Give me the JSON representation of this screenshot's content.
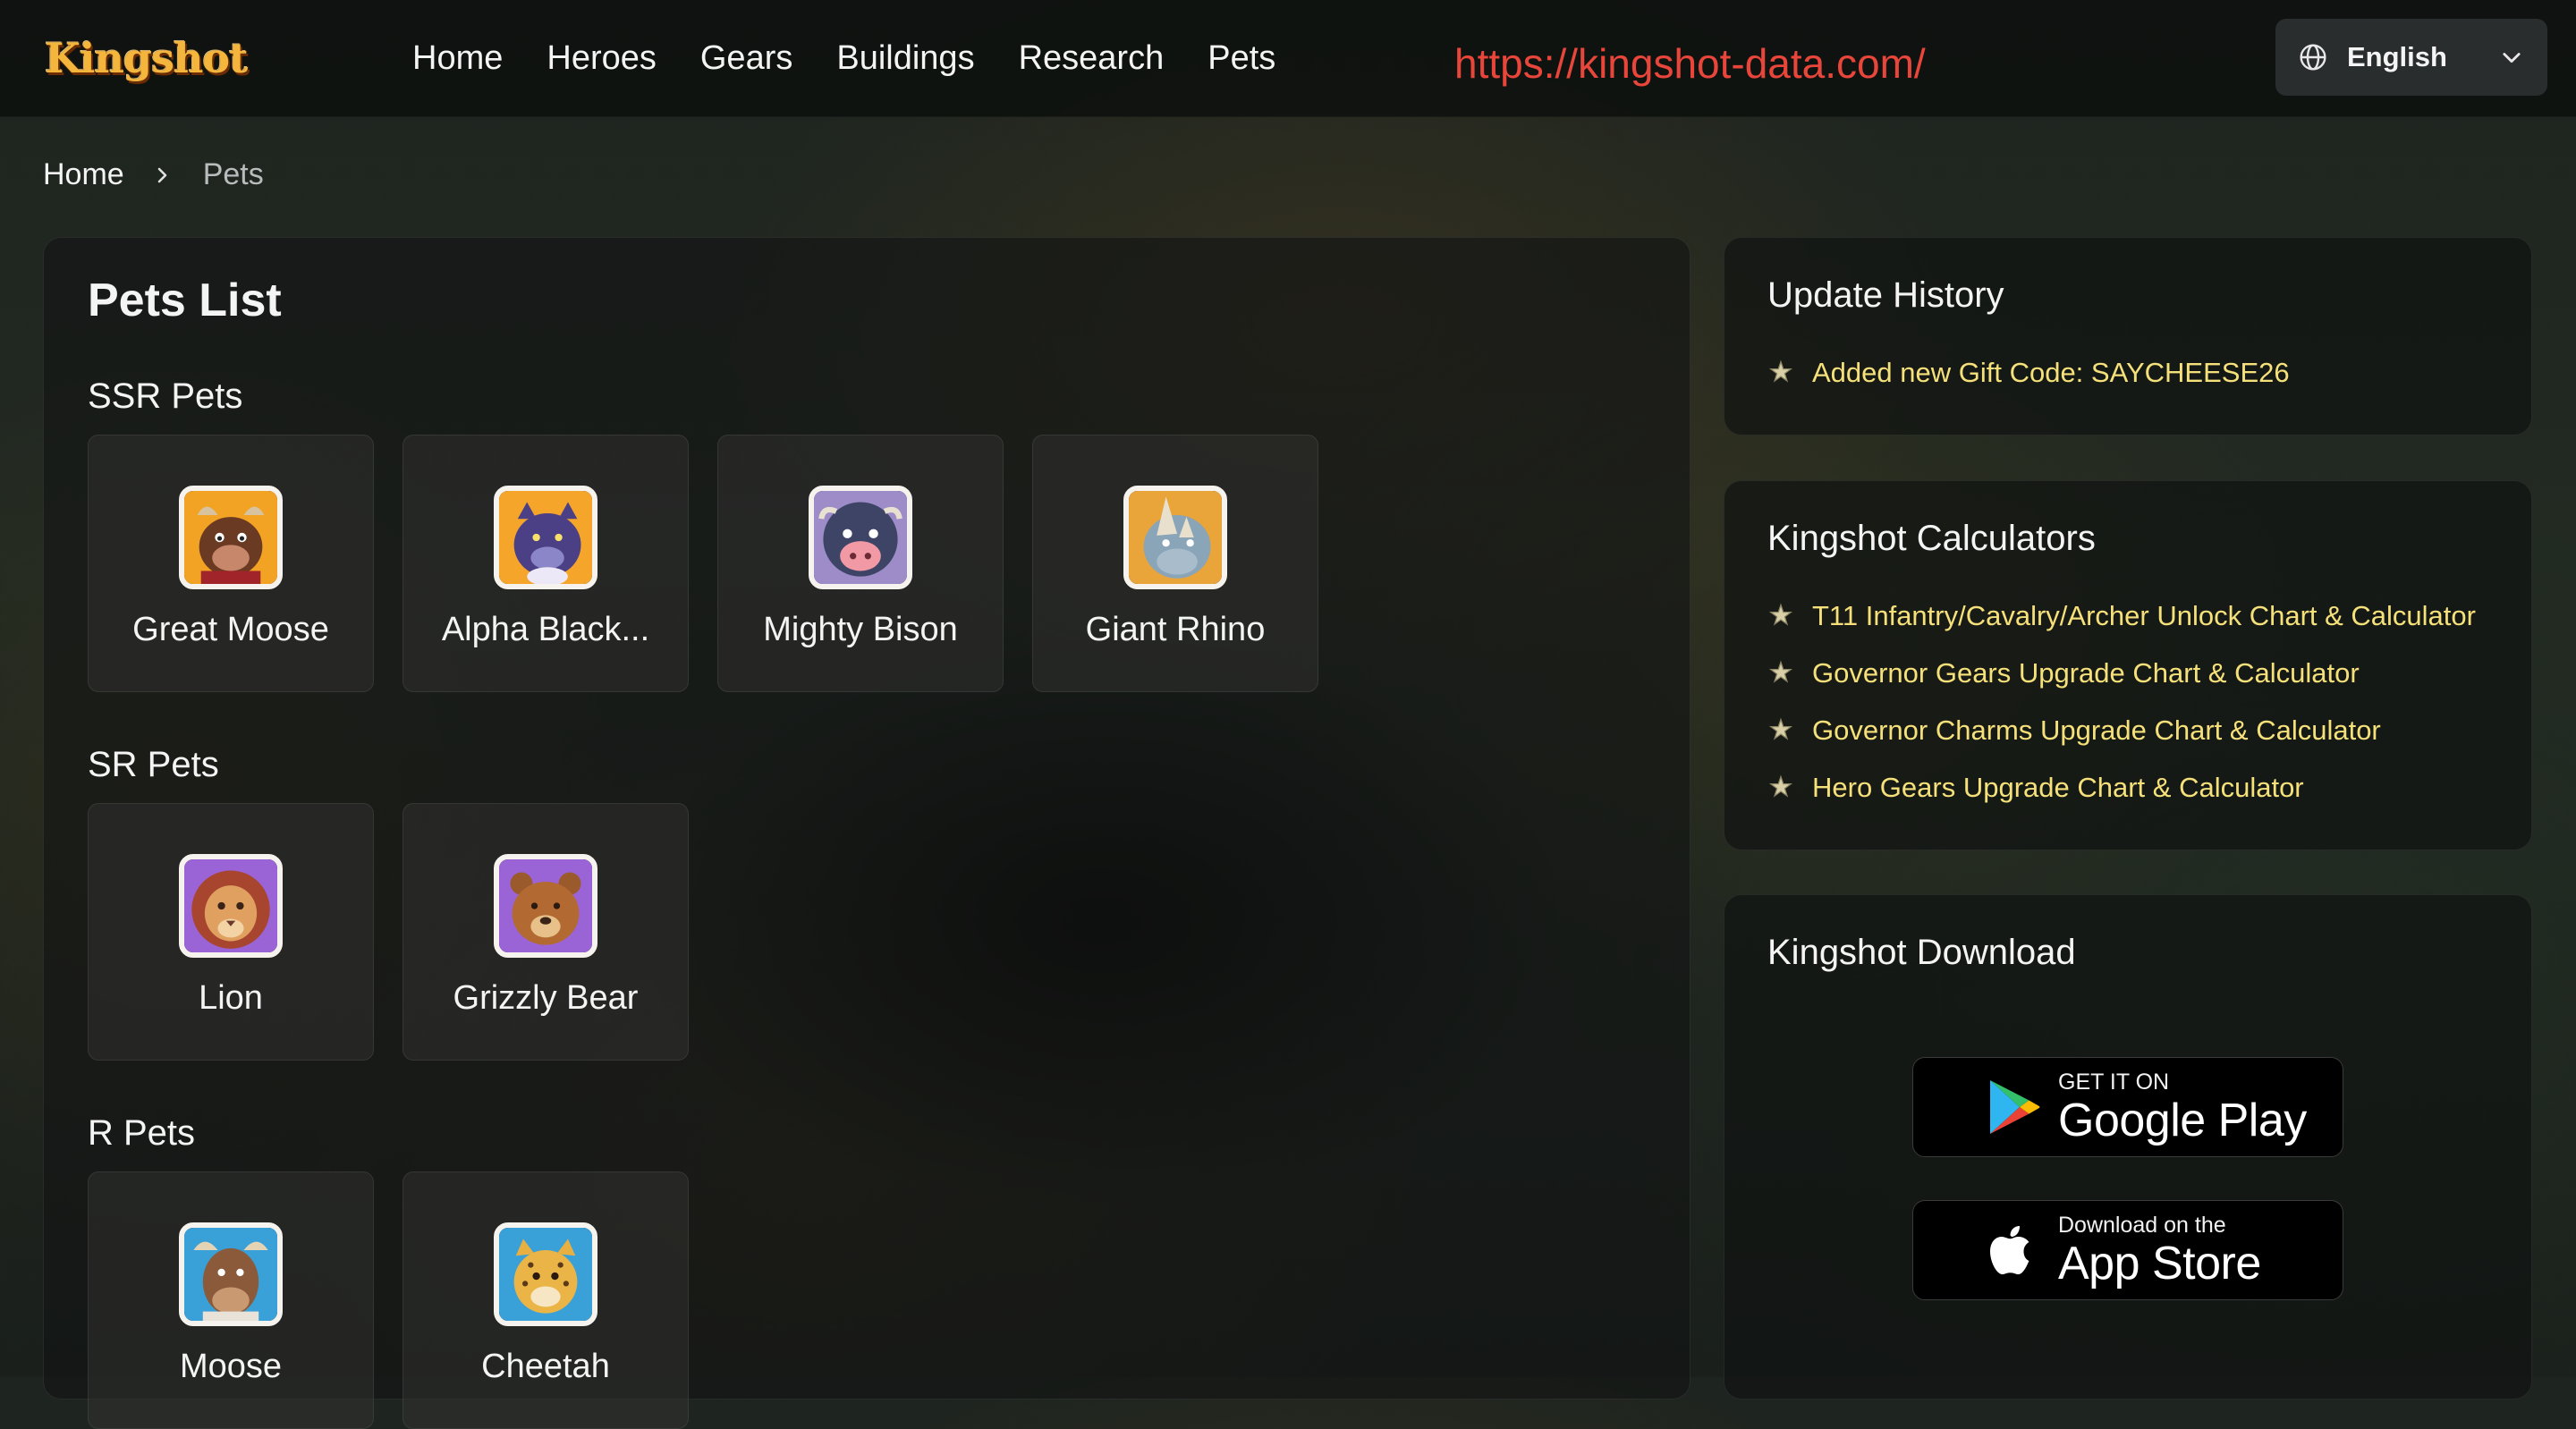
{
  "header": {
    "logo_text": "Kingshot",
    "nav": [
      "Home",
      "Heroes",
      "Gears",
      "Buildings",
      "Research",
      "Pets"
    ],
    "site_url": "https://kingshot-data.com/",
    "language": {
      "label": "English",
      "icon": "globe-icon"
    },
    "accent_color": "#e8453b"
  },
  "breadcrumb": {
    "home": "Home",
    "current": "Pets"
  },
  "main": {
    "title": "Pets List",
    "sections": [
      {
        "title": "SSR Pets",
        "pets": [
          "Great Moose",
          "Alpha Black...",
          "Mighty Bison",
          "Giant Rhino"
        ]
      },
      {
        "title": "SR Pets",
        "pets": [
          "Lion",
          "Grizzly Bear"
        ]
      },
      {
        "title": "R Pets",
        "pets": [
          "Moose",
          "Cheetah"
        ]
      }
    ]
  },
  "sidebar": {
    "update_history": {
      "title": "Update History",
      "items": [
        "Added new Gift Code: SAYCHEESE26"
      ]
    },
    "calculators": {
      "title": "Kingshot Calculators",
      "items": [
        "T11 Infantry/Cavalry/Archer Unlock Chart & Calculator",
        "Governor Gears Upgrade Chart & Calculator",
        "Governor Charms Upgrade Chart & Calculator",
        "Hero Gears Upgrade Chart & Calculator"
      ]
    },
    "download": {
      "title": "Kingshot Download",
      "google_play": {
        "small": "GET IT ON",
        "big": "Google Play"
      },
      "app_store": {
        "small": "Download on the",
        "big": "App Store"
      }
    },
    "link_color": "#f5e07a"
  }
}
